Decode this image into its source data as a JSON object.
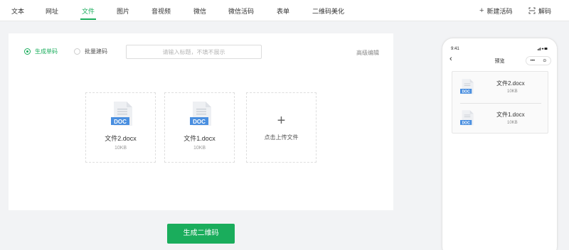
{
  "nav": {
    "tabs": [
      "文本",
      "网址",
      "文件",
      "图片",
      "音视频",
      "微信",
      "微信活码",
      "表单",
      "二维码美化"
    ],
    "active_tab": "文件",
    "new_code": "新建活码",
    "decode": "解码"
  },
  "editor": {
    "mode_single": "生成单码",
    "mode_batch": "批量建码",
    "selected_mode": "生成单码",
    "title_input_value": "",
    "title_placeholder": "请输入标题，不填不展示",
    "advanced": "高级编辑",
    "files": [
      {
        "name": "文件2.docx",
        "size": "10KB",
        "type_badge": "DOC"
      },
      {
        "name": "文件1.docx",
        "size": "10KB",
        "type_badge": "DOC"
      }
    ],
    "upload_label": "点击上传文件"
  },
  "generate_button": "生成二维码",
  "preview": {
    "time": "9:41",
    "title": "预览",
    "files": [
      {
        "name": "文件2.docx",
        "size": "10KB",
        "type_badge": "DOC"
      },
      {
        "name": "文件1.docx",
        "size": "10KB",
        "type_badge": "DOC"
      }
    ]
  },
  "colors": {
    "accent": "#1aad5c",
    "doc_badge": "#4a8fe0",
    "background": "#f2f3f5"
  },
  "icons": [
    "plus-icon",
    "scan-icon",
    "doc-file-icon",
    "back-arrow-icon",
    "capsule-more-icon",
    "capsule-close-icon"
  ]
}
